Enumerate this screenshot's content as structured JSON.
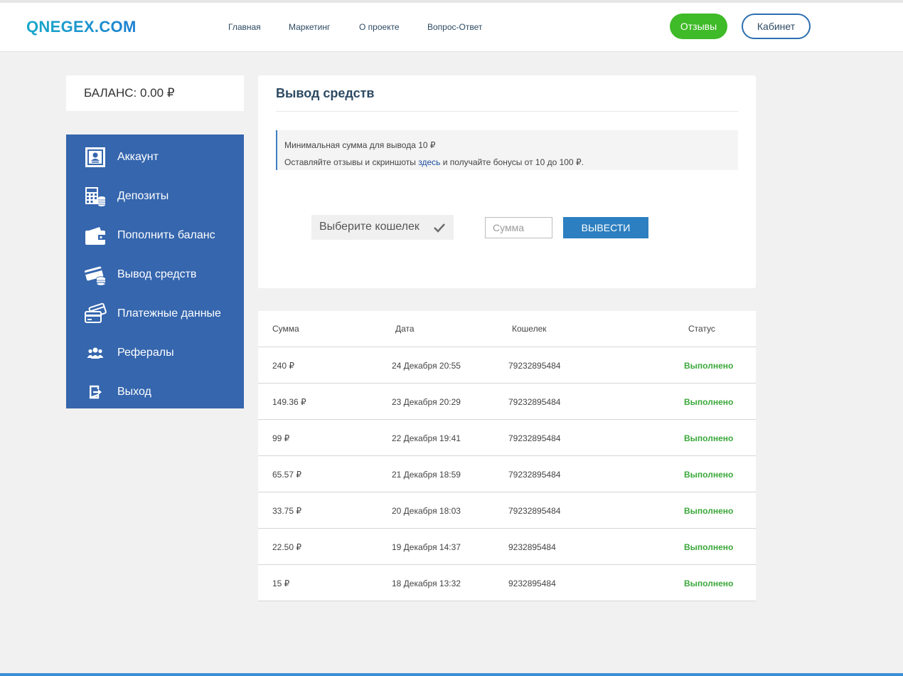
{
  "header": {
    "logo": "QNEGEX.COM",
    "nav": [
      "Главная",
      "Маркетинг",
      "О проекте",
      "Вопрос-Ответ"
    ],
    "reviews_label": "Отзывы",
    "cabinet_label": "Кабинет"
  },
  "balance": {
    "label": "БАЛАНС: 0.00 ₽"
  },
  "sidebar": {
    "items": [
      {
        "label": "Аккаунт",
        "icon": "account-card-icon"
      },
      {
        "label": "Депозиты",
        "icon": "calculator-coins-icon"
      },
      {
        "label": "Пополнить баланс",
        "icon": "wallet-icon"
      },
      {
        "label": "Вывод средств",
        "icon": "card-coins-icon"
      },
      {
        "label": "Платежные данные",
        "icon": "payment-cards-icon"
      },
      {
        "label": "Рефералы",
        "icon": "users-icon"
      },
      {
        "label": "Выход",
        "icon": "logout-icon"
      }
    ]
  },
  "withdraw": {
    "title": "Вывод средств",
    "notice_line1": "Минимальная сумма для вывода 10 ₽",
    "notice_line2_before": "Оставляйте отзывы и скриншоты ",
    "notice_link": "здесь",
    "notice_line2_after": " и получайте бонусы от 10 до 100 ₽.",
    "wallet_placeholder": "Выберите кошелек",
    "amount_placeholder": "Сумма",
    "submit_label": "ВЫВЕСТИ"
  },
  "history": {
    "columns": [
      "Сумма",
      "Дата",
      "Кошелек",
      "Статус"
    ],
    "rows": [
      {
        "amount": "240 ₽",
        "date": "24 Декабря 20:55",
        "wallet": "79232895484",
        "status": "Выполнено"
      },
      {
        "amount": "149.36 ₽",
        "date": "23 Декабря 20:29",
        "wallet": "79232895484",
        "status": "Выполнено"
      },
      {
        "amount": "99 ₽",
        "date": "22 Декабря 19:41",
        "wallet": "79232895484",
        "status": "Выполнено"
      },
      {
        "amount": "65.57 ₽",
        "date": "21 Декабря 18:59",
        "wallet": "79232895484",
        "status": "Выполнено"
      },
      {
        "amount": "33.75 ₽",
        "date": "20 Декабря 18:03",
        "wallet": "79232895484",
        "status": "Выполнено"
      },
      {
        "amount": "22.50 ₽",
        "date": "19 Декабря 14:37",
        "wallet": "9232895484",
        "status": "Выполнено"
      },
      {
        "amount": "15 ₽",
        "date": "18 Декабря 13:32",
        "wallet": "9232895484",
        "status": "Выполнено"
      }
    ]
  },
  "colors": {
    "sidebar_bg": "#3566ae",
    "reviews_btn": "#3fba28",
    "withdraw_btn": "#2c7fc0",
    "status_done": "#3aa83a",
    "heading": "#2d4a63"
  }
}
